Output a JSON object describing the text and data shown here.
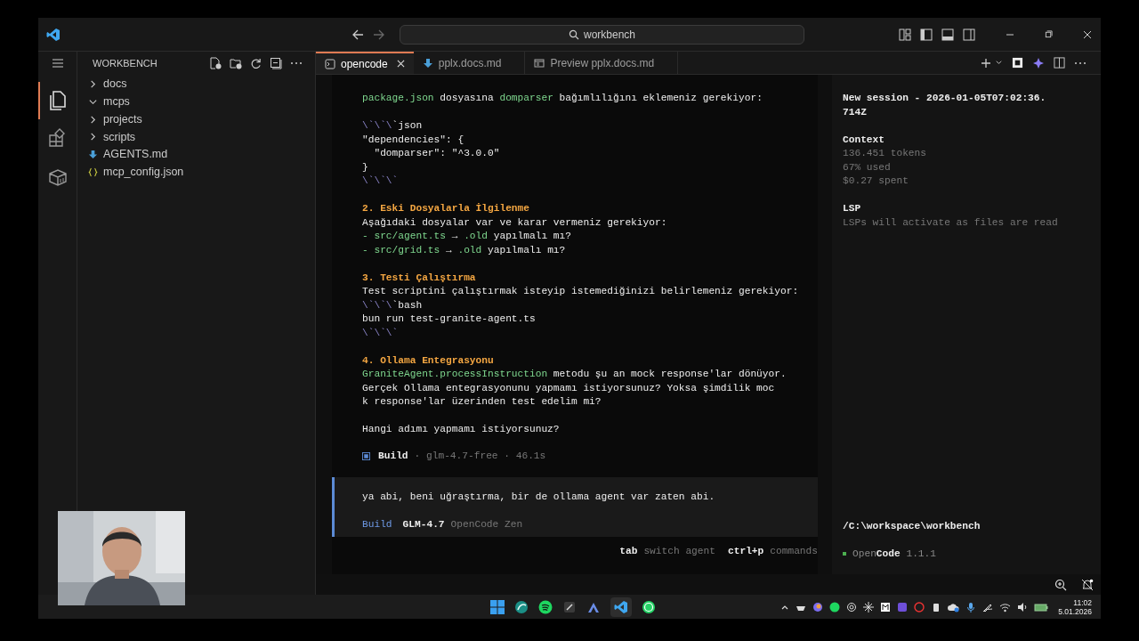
{
  "title_bar": {
    "search": "workbench"
  },
  "explorer": {
    "title": "WORKBENCH",
    "items": [
      {
        "label": "docs",
        "kind": "folder",
        "expanded": false
      },
      {
        "label": "mcps",
        "kind": "folder",
        "expanded": true
      },
      {
        "label": "projects",
        "kind": "folder",
        "expanded": false
      },
      {
        "label": "scripts",
        "kind": "folder",
        "expanded": false
      },
      {
        "label": "AGENTS.md",
        "kind": "markdown"
      },
      {
        "label": "mcp_config.json",
        "kind": "json"
      }
    ]
  },
  "tabs": [
    {
      "label": "opencode",
      "kind": "terminal",
      "selected": true
    },
    {
      "label": "pplx.docs.md",
      "kind": "markdown",
      "selected": false
    },
    {
      "label": "Preview pplx.docs.md",
      "kind": "preview",
      "selected": false
    }
  ],
  "chat": {
    "lines": [
      {
        "kind": "text",
        "segments": [
          {
            "kind": "code",
            "text": "package.json"
          },
          {
            "kind": "plain",
            "text": " dosyasına "
          },
          {
            "kind": "code",
            "text": "domparser"
          },
          {
            "kind": "plain",
            "text": " bağımlılığını eklemeniz gerekiyor:"
          }
        ]
      },
      {
        "kind": "blank"
      },
      {
        "kind": "text",
        "segments": [
          {
            "kind": "fence",
            "text": "\\`\\`\\"
          },
          {
            "kind": "plain",
            "text": "`json"
          }
        ]
      },
      {
        "kind": "text",
        "segments": [
          {
            "kind": "plain",
            "text": "\"dependencies\": {"
          }
        ]
      },
      {
        "kind": "text",
        "segments": [
          {
            "kind": "plain",
            "text": "  \"domparser\": \"^3.0.0\""
          }
        ]
      },
      {
        "kind": "text",
        "segments": [
          {
            "kind": "plain",
            "text": "}"
          }
        ]
      },
      {
        "kind": "text",
        "segments": [
          {
            "kind": "fence",
            "text": "\\`\\`\\`"
          }
        ]
      },
      {
        "kind": "blank"
      },
      {
        "kind": "text",
        "segments": [
          {
            "kind": "heading",
            "text": "2. Eski Dosyalarla İlgilenme"
          }
        ]
      },
      {
        "kind": "text",
        "segments": [
          {
            "kind": "plain",
            "text": "Aşağıdaki dosyalar var ve karar vermeniz gerekiyor:"
          }
        ]
      },
      {
        "kind": "text",
        "segments": [
          {
            "kind": "code",
            "text": "- src/agent.ts"
          },
          {
            "kind": "plain",
            "text": " → "
          },
          {
            "kind": "code",
            "text": ".old"
          },
          {
            "kind": "plain",
            "text": " yapılmalı mı?"
          }
        ]
      },
      {
        "kind": "text",
        "segments": [
          {
            "kind": "code",
            "text": "- src/grid.ts"
          },
          {
            "kind": "plain",
            "text": " → "
          },
          {
            "kind": "code",
            "text": ".old"
          },
          {
            "kind": "plain",
            "text": " yapılmalı mı?"
          }
        ]
      },
      {
        "kind": "blank"
      },
      {
        "kind": "text",
        "segments": [
          {
            "kind": "heading",
            "text": "3. Testi Çalıştırma"
          }
        ]
      },
      {
        "kind": "text",
        "segments": [
          {
            "kind": "plain",
            "text": "Test scriptini çalıştırmak isteyip istemediğinizi belirlemeniz gerekiyor:"
          }
        ]
      },
      {
        "kind": "text",
        "segments": [
          {
            "kind": "fence",
            "text": "\\`\\`\\"
          },
          {
            "kind": "plain",
            "text": "`bash"
          }
        ]
      },
      {
        "kind": "text",
        "segments": [
          {
            "kind": "plain",
            "text": "bun run test-granite-agent.ts"
          }
        ]
      },
      {
        "kind": "text",
        "segments": [
          {
            "kind": "fence",
            "text": "\\`\\`\\`"
          }
        ]
      },
      {
        "kind": "blank"
      },
      {
        "kind": "text",
        "segments": [
          {
            "kind": "heading",
            "text": "4. Ollama Entegrasyonu"
          }
        ]
      },
      {
        "kind": "text",
        "segments": [
          {
            "kind": "code",
            "text": "GraniteAgent.processInstruction"
          },
          {
            "kind": "plain",
            "text": " metodu şu an mock response'lar dönüyor."
          }
        ]
      },
      {
        "kind": "text",
        "segments": [
          {
            "kind": "plain",
            "text": "Gerçek Ollama entegrasyonunu yapmamı istiyorsunuz? Yoksa şimdilik moc"
          }
        ]
      },
      {
        "kind": "text",
        "segments": [
          {
            "kind": "plain",
            "text": "k response'lar üzerinden test edelim mi?"
          }
        ]
      },
      {
        "kind": "blank"
      },
      {
        "kind": "text",
        "segments": [
          {
            "kind": "plain",
            "text": "Hangi adımı yapmamı istiyorsunuz?"
          }
        ]
      }
    ],
    "build_status": {
      "agent": "Build",
      "model": "glm-4.7-free",
      "separator": "·",
      "duration": "46.1s"
    },
    "prompt": {
      "text": "ya abi, beni uğraştırma, bir de ollama agent var zaten abi.",
      "agent": "Build",
      "model": "GLM-4.7",
      "provider": "OpenCode Zen"
    },
    "hints": [
      {
        "key": "tab",
        "label": "switch agent"
      },
      {
        "key": "ctrl+p",
        "label": "commands"
      }
    ]
  },
  "session": {
    "title": "New session - 2026-01-05T07:02:36.714Z",
    "sections": [
      {
        "heading": "Context",
        "lines": [
          "136.451 tokens",
          "67% used",
          "$0.27 spent"
        ]
      },
      {
        "heading": "LSP",
        "lines": [
          "LSPs will activate as files are read"
        ]
      }
    ],
    "path": "/C:\\workspace\\workbench",
    "version": {
      "name_dim": "Open",
      "name_bold": "Code",
      "number": "1.1.1"
    }
  },
  "taskbar": {
    "time": "11:02",
    "date": "5.01.2026"
  }
}
